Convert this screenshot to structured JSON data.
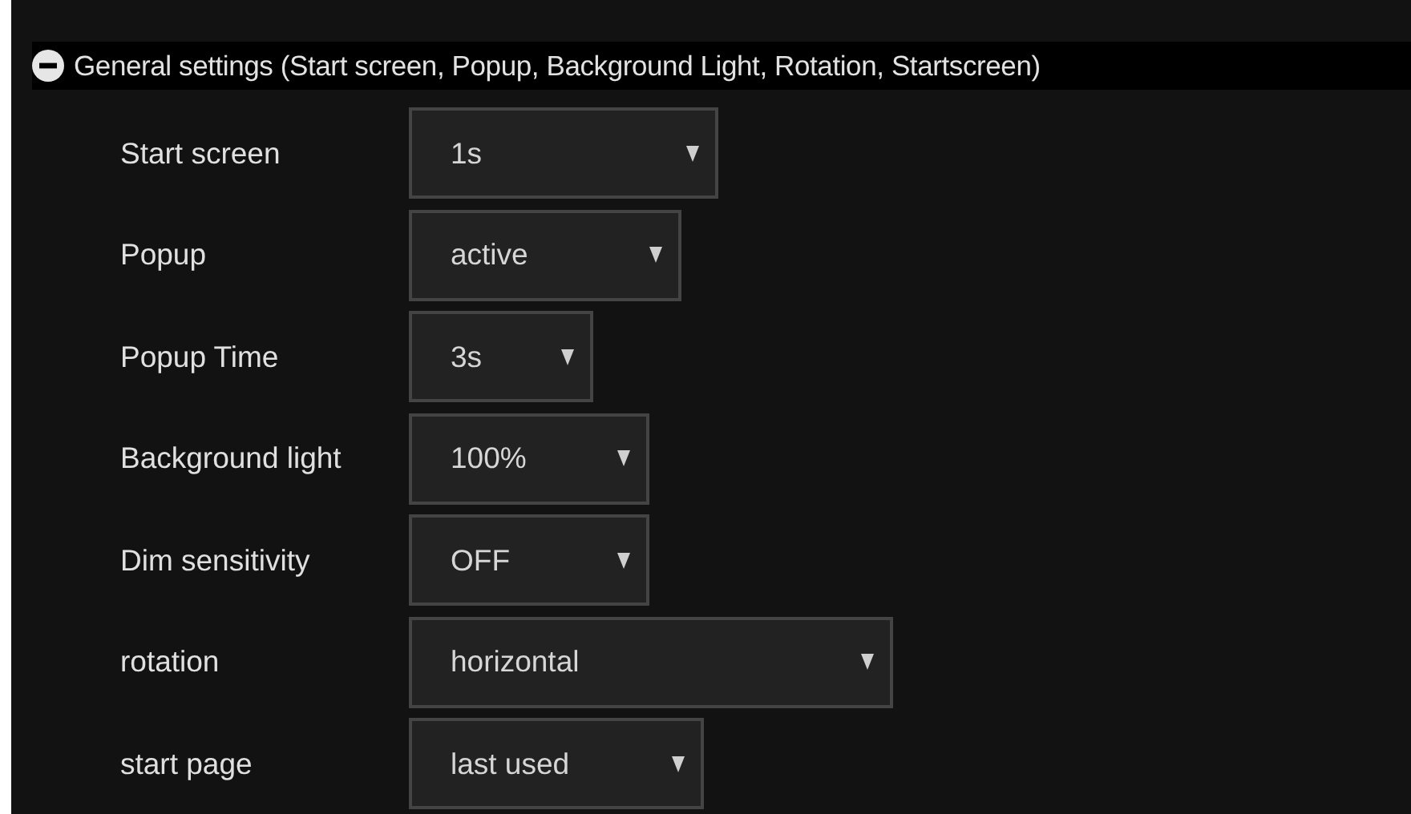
{
  "section": {
    "title": "General settings (Start screen, Popup, Background Light, Rotation, Startscreen)",
    "expanded": true
  },
  "settings": [
    {
      "label": "Start screen",
      "value": "1s"
    },
    {
      "label": "Popup",
      "value": "active"
    },
    {
      "label": "Popup Time",
      "value": "3s"
    },
    {
      "label": "Background light",
      "value": "100%"
    },
    {
      "label": "Dim sensitivity",
      "value": "OFF"
    },
    {
      "label": "rotation",
      "value": "horizontal"
    },
    {
      "label": "start page",
      "value": "last used"
    }
  ]
}
